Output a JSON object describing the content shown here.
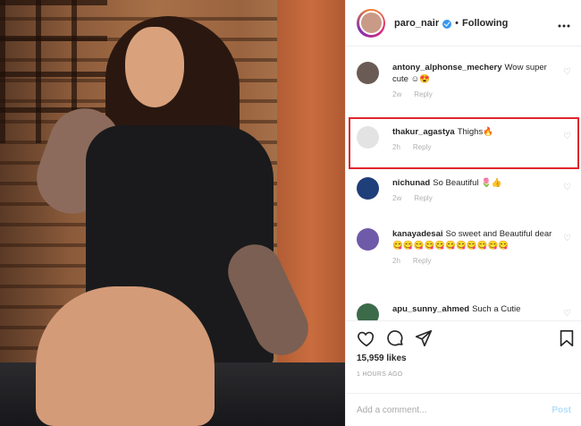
{
  "post": {
    "header": {
      "username": "paro_nair",
      "separator": "•",
      "follow_status": "Following",
      "more_icon": "more-horizontal-icon"
    },
    "comments": [
      {
        "username": "antony_alphonse_mechery",
        "text": "Wow super cute ☺😍",
        "reply": "Reply",
        "time": "2w",
        "avatar_color": "#6b5b55"
      },
      {
        "username": "thakur_agastya",
        "text": "Thighs🔥",
        "reply": "Reply",
        "time": "2h",
        "avatar_color": "#e3e3e3",
        "highlighted": true
      },
      {
        "username": "nichunad",
        "text": "So Beautiful 🌷👍",
        "reply": "Reply",
        "time": "2w",
        "avatar_color": "#1f3f7a"
      },
      {
        "username": "kanayadesai",
        "text": "So sweet and Beautiful dear 😋😋😋😋😋😋😋😋😋😋😋",
        "reply": "Reply",
        "time": "2h",
        "avatar_color": "#6e5aa8"
      },
      {
        "username": "apu_sunny_ahmed",
        "text": "Such a Cutie",
        "reply": "",
        "time": "",
        "avatar_color": "#3c6b4a"
      }
    ],
    "actions": {
      "like_icon": "heart-icon",
      "comment_icon": "comment-icon",
      "share_icon": "share-icon",
      "save_icon": "bookmark-icon",
      "likes": "15,959 likes",
      "timestamp": "1 HOURS AGO"
    },
    "add_comment": {
      "placeholder": "Add a comment...",
      "post_label": "Post"
    }
  },
  "colors": {
    "highlight_border": "#e0262b",
    "verified_badge": "#3897f0",
    "post_button_disabled": "#b2dffc"
  }
}
